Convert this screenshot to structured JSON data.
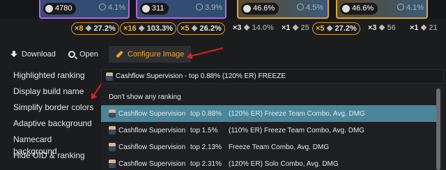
{
  "cards": [
    {
      "value": "4780",
      "faded": "4.1%",
      "icon": "shield-icon"
    },
    {
      "value": "311",
      "faded": "3.9%",
      "icon": "sword-icon"
    },
    {
      "value": "46.6%",
      "faded": "4.5%",
      "icon": "sword-icon"
    },
    {
      "value": "46.6%",
      "faded": "4.1%",
      "icon": "snowflake-icon"
    }
  ],
  "substats": [
    {
      "count": "×8",
      "value": "27.2%",
      "active": true
    },
    {
      "count": "×16",
      "value": "103.3%",
      "active": true
    },
    {
      "count": "×5",
      "value": "26.2%",
      "active": true
    },
    {
      "count": "×3",
      "value": "14.0%",
      "active": false
    },
    {
      "count": "×1",
      "value": "25",
      "active": false
    },
    {
      "count": "×5",
      "value": "27.2%",
      "active": true
    },
    {
      "count": "×3",
      "value": "56",
      "active": false
    },
    {
      "count": "×1",
      "value": "21",
      "active": false
    }
  ],
  "toolbar": {
    "download_label": "Download",
    "open_label": "Open",
    "configure_label": "Configure Image"
  },
  "options": [
    "Highlighted ranking",
    "Display build name",
    "Simplify border colors",
    "Adaptive background",
    "Namecard background",
    "Hide UID & ranking"
  ],
  "dropdown": {
    "selected_value": "Cashflow Supervision - top 0.88% (120% ER) FREEZE",
    "none_label": "Don't show any ranking",
    "items": [
      {
        "name": "Cashflow Supervision",
        "top": "top 0.88%",
        "desc": "(120% ER) Freeze Team Combo, Avg. DMG"
      },
      {
        "name": "Cashflow Supervision",
        "top": "top 1.5%",
        "desc": "(110% ER) Freeze Team Combo, Avg. DMG"
      },
      {
        "name": "Cashflow Supervision",
        "top": "top 2.13%",
        "desc": "Freeze Team Combo, Avg. DMG"
      },
      {
        "name": "Cashflow Supervision",
        "top": "top 2.31%",
        "desc": "(120% ER) Solo Combo, Avg. DMG"
      }
    ]
  },
  "colors": {
    "accent": "#f0a51e",
    "selected_row": "#4a869a",
    "annotation": "#e02020"
  }
}
